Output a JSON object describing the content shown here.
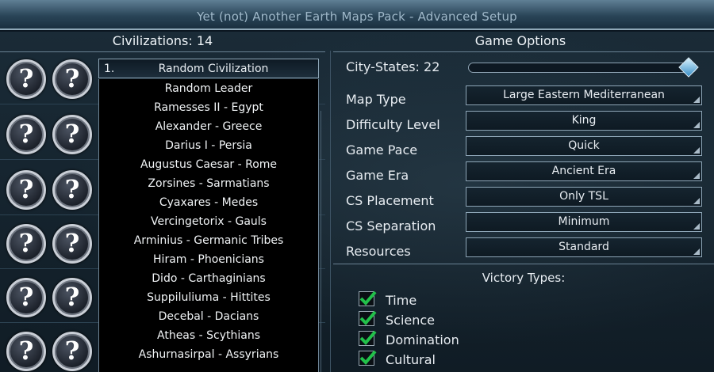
{
  "window": {
    "title": "Yet (not) Another Earth Maps Pack - Advanced Setup"
  },
  "left_panel": {
    "header": "Civilizations: 14",
    "rows": [
      {
        "leader_icon": "?",
        "civ_icon": "?"
      },
      {
        "leader_icon": "?",
        "civ_icon": "?"
      },
      {
        "leader_icon": "?",
        "civ_icon": "?"
      },
      {
        "leader_icon": "?",
        "civ_icon": "?"
      },
      {
        "leader_icon": "?",
        "civ_icon": "?"
      },
      {
        "leader_icon": "?",
        "civ_icon": "?"
      }
    ],
    "dropdown": {
      "number": "1.",
      "selected": "Random Civilization",
      "items": [
        "Random Leader",
        "Ramesses II - Egypt",
        "Alexander - Greece",
        "Darius I - Persia",
        "Augustus Caesar - Rome",
        "Zorsines - Sarmatians",
        "Cyaxares - Medes",
        "Vercingetorix - Gauls",
        "Arminius - Germanic Tribes",
        "Hiram - Phoenicians",
        "Dido - Carthaginians",
        "Suppiluliuma - Hittites",
        "Decebal - Dacians",
        "Atheas - Scythians",
        "Ashurnasirpal - Assyrians"
      ]
    }
  },
  "right_panel": {
    "header": "Game Options",
    "city_states": {
      "label": "City-States: 22",
      "level": 1.0
    },
    "options": [
      {
        "label": "Map Type",
        "value": "Large Eastern Mediterranean"
      },
      {
        "label": "Difficulty Level",
        "value": "King"
      },
      {
        "label": "Game Pace",
        "value": "Quick"
      },
      {
        "label": "Game Era",
        "value": "Ancient Era"
      },
      {
        "label": "CS Placement",
        "value": "Only TSL"
      },
      {
        "label": "CS Separation",
        "value": "Minimum"
      },
      {
        "label": "Resources",
        "value": "Standard"
      }
    ],
    "victory": {
      "title": "Victory Types:",
      "items": [
        {
          "label": "Time",
          "checked": true
        },
        {
          "label": "Science",
          "checked": true
        },
        {
          "label": "Domination",
          "checked": true
        },
        {
          "label": "Cultural",
          "checked": true
        }
      ]
    }
  },
  "colors": {
    "checkmark": "#22c04a",
    "slider_thumb": "#6cc3f0"
  }
}
